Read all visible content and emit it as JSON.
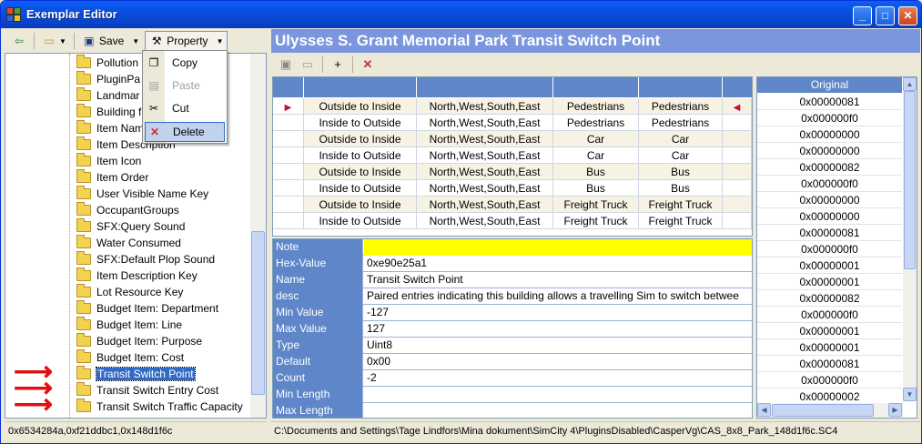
{
  "window": {
    "title": "Exemplar Editor",
    "minimize": "_",
    "maximize": "□",
    "close": "✕"
  },
  "left_toolbar": {
    "save_label": "Save",
    "property_label": "Property"
  },
  "context_menu": {
    "items": [
      {
        "label": "Copy",
        "enabled": true
      },
      {
        "label": "Paste",
        "enabled": false
      },
      {
        "label": "Cut",
        "enabled": true
      },
      {
        "label": "Delete",
        "enabled": true
      }
    ]
  },
  "tree": {
    "items": [
      "Pollution",
      "PluginPa",
      "Landmar",
      "Building f",
      "Item Nam",
      "Item Description",
      "Item Icon",
      "Item Order",
      "User Visible Name Key",
      "OccupantGroups",
      "SFX:Query Sound",
      "Water Consumed",
      "SFX:Default Plop Sound",
      "Item Description Key",
      "Lot Resource Key",
      "Budget Item: Department",
      "Budget Item: Line",
      "Budget Item: Purpose",
      "Budget Item: Cost",
      "Transit Switch Point",
      "Transit Switch Entry Cost",
      "Transit Switch Traffic Capacity"
    ],
    "selected_index": 19
  },
  "right_header": {
    "title": "Ulysses S. Grant Memorial Park Transit Switch Point"
  },
  "grid": {
    "rows": [
      [
        "Outside to Inside",
        "North,West,South,East",
        "Pedestrians",
        "Pedestrians"
      ],
      [
        "Inside to Outside",
        "North,West,South,East",
        "Pedestrians",
        "Pedestrians"
      ],
      [
        "Outside to Inside",
        "North,West,South,East",
        "Car",
        "Car"
      ],
      [
        "Inside to Outside",
        "North,West,South,East",
        "Car",
        "Car"
      ],
      [
        "Outside to Inside",
        "North,West,South,East",
        "Bus",
        "Bus"
      ],
      [
        "Inside to Outside",
        "North,West,South,East",
        "Bus",
        "Bus"
      ],
      [
        "Outside to Inside",
        "North,West,South,East",
        "Freight Truck",
        "Freight Truck"
      ],
      [
        "Inside to Outside",
        "North,West,South,East",
        "Freight Truck",
        "Freight Truck"
      ]
    ]
  },
  "properties": {
    "rows": [
      {
        "key": "Note",
        "value": ""
      },
      {
        "key": "Hex-Value",
        "value": "0xe90e25a1"
      },
      {
        "key": "Name",
        "value": "Transit Switch Point"
      },
      {
        "key": "desc",
        "value": "Paired entries indicating this building allows a travelling Sim to switch betwee"
      },
      {
        "key": "Min Value",
        "value": "-127"
      },
      {
        "key": "Max Value",
        "value": "127"
      },
      {
        "key": "Type",
        "value": "Uint8"
      },
      {
        "key": "Default",
        "value": "0x00"
      },
      {
        "key": "Count",
        "value": "-2"
      },
      {
        "key": "Min Length",
        "value": ""
      },
      {
        "key": "Max Length",
        "value": ""
      }
    ],
    "note_color": "#ffff00"
  },
  "original": {
    "header": "Original",
    "values": [
      "0x00000081",
      "0x000000f0",
      "0x00000000",
      "0x00000000",
      "0x00000082",
      "0x000000f0",
      "0x00000000",
      "0x00000000",
      "0x00000081",
      "0x000000f0",
      "0x00000001",
      "0x00000001",
      "0x00000082",
      "0x000000f0",
      "0x00000001",
      "0x00000001",
      "0x00000081",
      "0x000000f0",
      "0x00000002"
    ]
  },
  "status": {
    "left": "0x6534284a,0xf21ddbc1,0x148d1f6c",
    "right": "C:\\Documents and Settings\\Tage Lindfors\\Mina dokument\\SimCity 4\\PluginsDisabled\\CasperVg\\CAS_8x8_Park_148d1f6c.SC4"
  },
  "colors": {
    "header_blue": "#7a96df",
    "selection": "#316ac5",
    "arrow_red": "#e01010"
  }
}
